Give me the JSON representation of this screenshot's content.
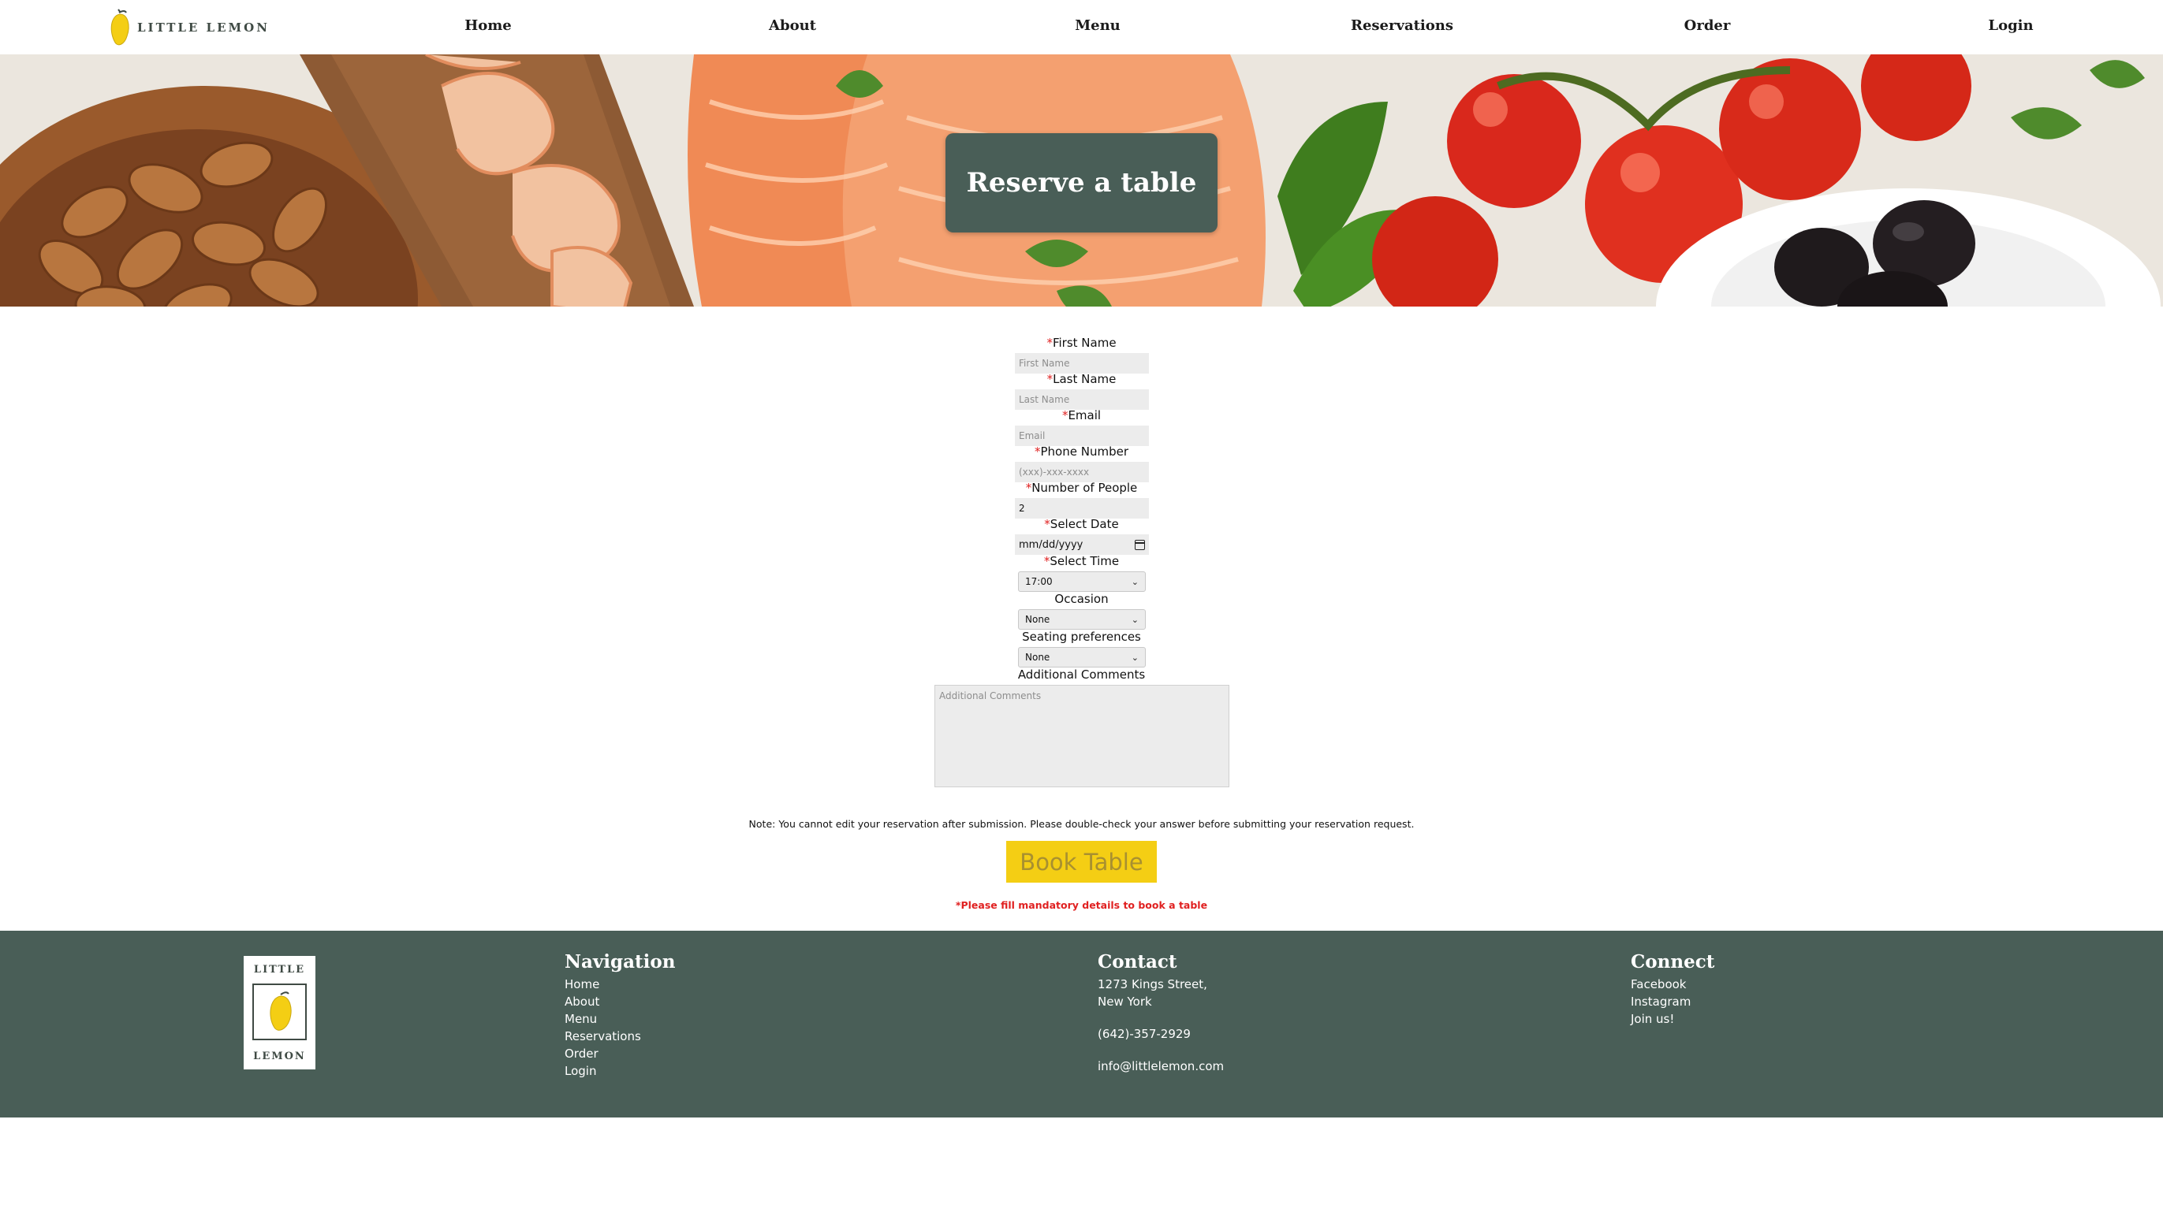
{
  "header": {
    "logo_text": "LITTLE LEMON",
    "nav": [
      "Home",
      "About",
      "Menu",
      "Reservations",
      "Order",
      "Login"
    ]
  },
  "hero": {
    "title": "Reserve a table"
  },
  "form": {
    "first_name": {
      "label": "First Name",
      "required_mark": "*",
      "placeholder": "First Name"
    },
    "last_name": {
      "label": "Last Name",
      "required_mark": "*",
      "placeholder": "Last Name"
    },
    "email": {
      "label": "Email",
      "required_mark": "*",
      "placeholder": "Email"
    },
    "phone": {
      "label": "Phone Number",
      "required_mark": "*",
      "placeholder": "(xxx)-xxx-xxxx"
    },
    "people": {
      "label": "Number of People",
      "required_mark": "*",
      "value": "2"
    },
    "date": {
      "label": "Select Date",
      "required_mark": "*",
      "value": "mm/dd/yyyy"
    },
    "time": {
      "label": "Select Time",
      "required_mark": "*",
      "value": "17:00"
    },
    "occasion": {
      "label": "Occasion",
      "value": "None"
    },
    "seating": {
      "label": "Seating preferences",
      "value": "None"
    },
    "comments": {
      "label": "Additional Comments",
      "placeholder": "Additional Comments"
    },
    "note": "Note: You cannot edit your reservation after submission. Please double-check your answer before submitting your reservation request.",
    "submit_label": "Book Table",
    "mandatory_message": "*Please fill mandatory details to book a table"
  },
  "footer": {
    "logo_top": "LITTLE",
    "logo_bottom": "LEMON",
    "navigation": {
      "title": "Navigation",
      "links": [
        "Home",
        "About",
        "Menu",
        "Reservations",
        "Order",
        "Login"
      ]
    },
    "contact": {
      "title": "Contact",
      "address_line1": "1273 Kings Street,",
      "address_line2": "New York",
      "phone": "(642)-357-2929",
      "email": "info@littlelemon.com"
    },
    "connect": {
      "title": "Connect",
      "links": [
        "Facebook",
        "Instagram",
        "Join us!"
      ]
    }
  },
  "colors": {
    "primary_green": "#495e57",
    "accent_yellow": "#f4ce14",
    "error_red": "#e02020",
    "input_gray": "#ececec"
  }
}
